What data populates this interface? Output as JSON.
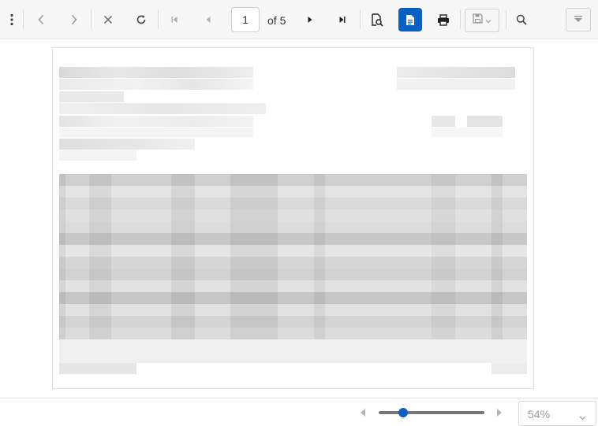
{
  "toolbar": {
    "current_page": "1",
    "of_label": "of 5",
    "icons": [
      "more-vertical-icon",
      "chevron-left-icon",
      "chevron-right-icon",
      "close-icon",
      "refresh-icon",
      "first-page-icon",
      "previous-page-icon",
      "next-page-icon",
      "last-page-icon",
      "search-document-icon",
      "document-icon",
      "print-icon",
      "save-icon",
      "search-icon",
      "collapse-toolbar-icon"
    ],
    "accent_color": "#0b5fc1"
  },
  "zoom": {
    "label": "54%",
    "value": 54
  }
}
